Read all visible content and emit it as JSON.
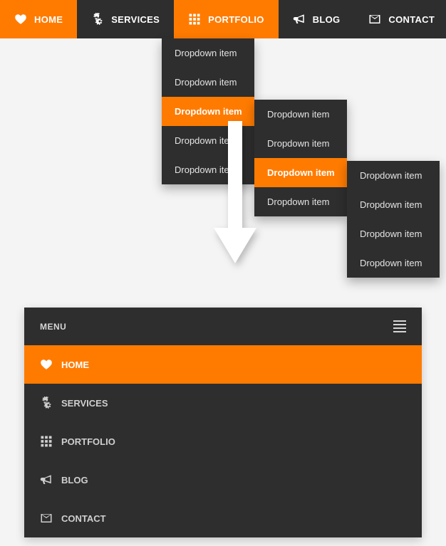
{
  "colors": {
    "accent": "#ff7b00",
    "dark": "#2e2e2e"
  },
  "nav": {
    "items": [
      {
        "label": "HOME",
        "icon": "heart-icon",
        "active": true
      },
      {
        "label": "SERVICES",
        "icon": "gears-icon"
      },
      {
        "label": "PORTFOLIO",
        "icon": "grid-icon",
        "active": true
      },
      {
        "label": "BLOG",
        "icon": "bullhorn-icon"
      },
      {
        "label": "CONTACT",
        "icon": "envelope-icon"
      }
    ]
  },
  "dropdown1": {
    "items": [
      {
        "label": "Dropdown item"
      },
      {
        "label": "Dropdown item"
      },
      {
        "label": "Dropdown item",
        "selected": true
      },
      {
        "label": "Dropdown item"
      },
      {
        "label": "Dropdown item"
      }
    ]
  },
  "dropdown2": {
    "items": [
      {
        "label": "Dropdown item"
      },
      {
        "label": "Dropdown item"
      },
      {
        "label": "Dropdown item",
        "selected": true
      },
      {
        "label": "Dropdown item"
      }
    ]
  },
  "dropdown3": {
    "items": [
      {
        "label": "Dropdown item"
      },
      {
        "label": "Dropdown item"
      },
      {
        "label": "Dropdown item"
      },
      {
        "label": "Dropdown item"
      }
    ]
  },
  "mobile": {
    "header": "MENU",
    "items": [
      {
        "label": "HOME",
        "icon": "heart-icon",
        "active": true
      },
      {
        "label": "SERVICES",
        "icon": "gears-icon"
      },
      {
        "label": "PORTFOLIO",
        "icon": "grid-icon"
      },
      {
        "label": "BLOG",
        "icon": "bullhorn-icon"
      },
      {
        "label": "CONTACT",
        "icon": "envelope-icon"
      }
    ]
  }
}
